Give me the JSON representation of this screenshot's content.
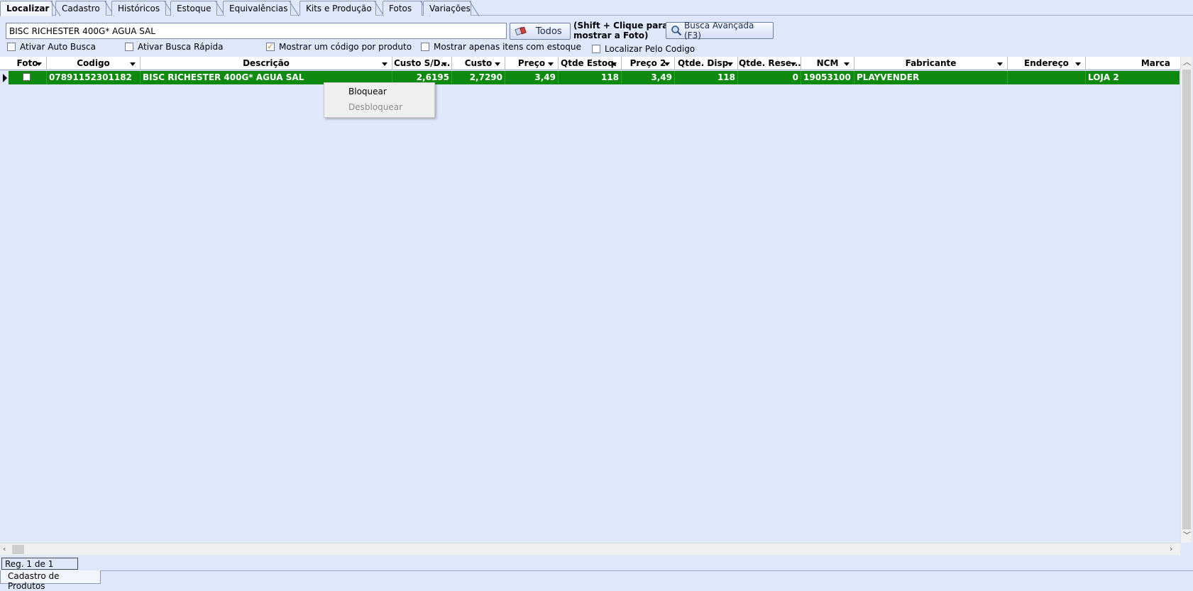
{
  "tabs": [
    "Localizar",
    "Cadastro",
    "Históricos",
    "Estoque",
    "Equivalências",
    "Kits e Produção",
    "Fotos",
    "Variações"
  ],
  "search": {
    "value": "BISC RICHESTER 400G* AGUA SAL",
    "todos_label": "Todos",
    "hint_line1": "(Shift + Clique para",
    "hint_line2": "mostrar a Foto)",
    "advanced_label": "Busca Avançada (F3)"
  },
  "options": {
    "auto_busca": {
      "label": "Ativar Auto Busca",
      "checked": false
    },
    "busca_rapida": {
      "label": "Ativar Busca Rápida",
      "checked": false
    },
    "um_codigo": {
      "label": "Mostrar um código por produto",
      "checked": true
    },
    "com_estoque": {
      "label": "Mostrar apenas itens com estoque",
      "checked": false
    },
    "pelo_codigo": {
      "label": "Localizar Pelo Codigo",
      "checked": false
    }
  },
  "grid": {
    "columns": [
      "Foto",
      "Codigo",
      "Descrição",
      "Custo S/D...",
      "Custo",
      "Preço",
      "Qtde Estoq.",
      "Preço 2",
      "Qtde. Disp.",
      "Qtde. Rese...",
      "NCM",
      "Fabricante",
      "Endereço",
      "Marca"
    ],
    "row": {
      "codigo": "07891152301182",
      "descricao": "BISC RICHESTER 400G* AGUA SAL",
      "custo_sd": "2,6195",
      "custo": "2,7290",
      "preco": "3,49",
      "qtde_estoq": "118",
      "preco2": "3,49",
      "qtde_disp": "118",
      "qtde_rese": "0",
      "ncm": "19053100",
      "fabricante": "PLAYVENDER",
      "endereco": "",
      "marca": "LOJA 2"
    },
    "row_color": "#0d8a0d"
  },
  "context_menu": {
    "items": [
      {
        "label": "Bloquear",
        "enabled": true
      },
      {
        "label": "Desbloquear",
        "enabled": false
      }
    ]
  },
  "status": {
    "record": "Reg. 1 de 1",
    "bottom_tab": "Cadastro de Produtos"
  }
}
